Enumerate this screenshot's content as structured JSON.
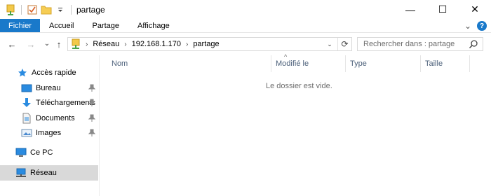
{
  "window": {
    "title": "partage",
    "controls": {
      "minimize": "—",
      "maximize": "☐",
      "close": "✕"
    }
  },
  "quick_access_toolbar": {
    "icons": [
      "properties-icon",
      "checkbox-icon",
      "new-folder-icon",
      "customize-dropdown-icon"
    ]
  },
  "ribbon": {
    "tabs": [
      {
        "label": "Fichier",
        "active": true
      },
      {
        "label": "Accueil"
      },
      {
        "label": "Partage"
      },
      {
        "label": "Affichage"
      }
    ],
    "expand_glyph": "⌄",
    "help_glyph": "?"
  },
  "navigation": {
    "back_glyph": "←",
    "forward_glyph": "→",
    "recent_glyph": "⌄",
    "up_glyph": "↑"
  },
  "address": {
    "crumbs": [
      "Réseau",
      "192.168.1.170",
      "partage"
    ],
    "separator": "›",
    "dropdown_glyph": "⌄",
    "refresh_glyph": "⟳"
  },
  "search": {
    "placeholder": "Rechercher dans : partage"
  },
  "nav_pane": {
    "items": [
      {
        "label": "Accès rapide",
        "icon": "star-icon",
        "pinned": false,
        "selected": false
      },
      {
        "label": "Bureau",
        "icon": "desktop-icon",
        "pinned": true,
        "selected": false
      },
      {
        "label": "Téléchargements",
        "icon": "download-icon",
        "pinned": true,
        "selected": false
      },
      {
        "label": "Documents",
        "icon": "documents-icon",
        "pinned": true,
        "selected": false
      },
      {
        "label": "Images",
        "icon": "pictures-icon",
        "pinned": true,
        "selected": false
      },
      {
        "label": "Ce PC",
        "icon": "computer-icon",
        "pinned": false,
        "selected": false
      },
      {
        "label": "Réseau",
        "icon": "network-icon",
        "pinned": false,
        "selected": true
      }
    ]
  },
  "content": {
    "columns": [
      "Nom",
      "Modifié le",
      "Type",
      "Taille"
    ],
    "sort_glyph": "^",
    "empty_message": "Le dossier est vide."
  },
  "colors": {
    "accent": "#1979ca",
    "header_text": "#4c607a",
    "muted_text": "#6d6d6d",
    "selected_bg": "#d9d9d9"
  }
}
